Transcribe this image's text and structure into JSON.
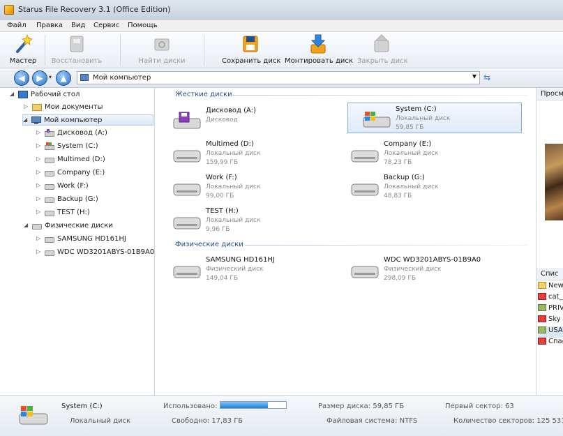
{
  "window": {
    "title": "Starus File Recovery 3.1 (Office Edition)"
  },
  "menu": [
    "Файл",
    "Правка",
    "Вид",
    "Сервис",
    "Помощь"
  ],
  "toolbar": {
    "wizard": "Мастер",
    "restore": "Восстановить",
    "find_disks": "Найти диски",
    "save_disk": "Сохранить диск",
    "mount_disk": "Монтировать диск",
    "close_disk": "Закрыть диск"
  },
  "address": {
    "path": "Мой компьютер"
  },
  "tree": {
    "desktop": "Рабочий стол",
    "my_docs": "Мои документы",
    "my_computer": "Мой компьютер",
    "drives": [
      "Дисковод (A:)",
      "System (C:)",
      "Multimed (D:)",
      "Company (E:)",
      "Work (F:)",
      "Backup (G:)",
      "TEST (H:)"
    ],
    "physical": "Физические диски",
    "physical_disks": [
      "SAMSUNG HD161HJ",
      "WDC WD3201ABYS-01B9A0"
    ]
  },
  "main": {
    "hard_disks_header": "Жесткие диски",
    "physical_header": "Физические диски",
    "disks": [
      {
        "name": "Дисковод (A:)",
        "type": "Дисковод",
        "size": ""
      },
      {
        "name": "System (C:)",
        "type": "Локальный диск",
        "size": "59,85 ГБ"
      },
      {
        "name": "Multimed (D:)",
        "type": "Локальный диск",
        "size": "159,99 ГБ"
      },
      {
        "name": "Company (E:)",
        "type": "Локальный диск",
        "size": "78,23 ГБ"
      },
      {
        "name": "Work (F:)",
        "type": "Локальный диск",
        "size": "99,00 ГБ"
      },
      {
        "name": "Backup (G:)",
        "type": "Локальный диск",
        "size": "48,83 ГБ"
      },
      {
        "name": "TEST (H:)",
        "type": "Локальный диск",
        "size": "9,96 ГБ"
      }
    ],
    "physical_disks": [
      {
        "name": "SAMSUNG HD161HJ",
        "type": "Физический диск",
        "size": "149,04 ГБ"
      },
      {
        "name": "WDC WD3201ABYS-01B9A0",
        "type": "Физический диск",
        "size": "298,09 ГБ"
      }
    ]
  },
  "right_panel": {
    "preview_header": "Просм",
    "list_header": "Спис",
    "files": [
      "New",
      "cat_",
      "PRIV",
      "Sky l",
      "USA",
      "Спас"
    ]
  },
  "status": {
    "disk_name": "System (C:)",
    "disk_type": "Локальный диск",
    "used_label": "Использовано:",
    "used_fraction": 0.72,
    "free": "Свободно: 17,83 ГБ",
    "disk_size": "Размер диска: 59,85 ГБ",
    "filesystem": "Файловая система: NTFS",
    "first_sector": "Первый сектор: 63",
    "sector_count": "Количество секторов: 125 531 8"
  },
  "colors": {
    "accent": "#2a6fc4",
    "selection": "#dfeaf8",
    "group_header": "#1c4b8c"
  }
}
